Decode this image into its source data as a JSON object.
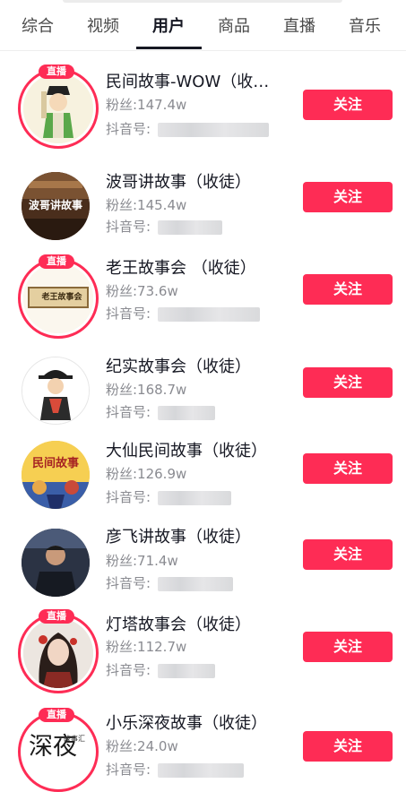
{
  "tabs": [
    {
      "label": "综合"
    },
    {
      "label": "视频"
    },
    {
      "label": "用户",
      "active": true
    },
    {
      "label": "商品"
    },
    {
      "label": "直播"
    },
    {
      "label": "音乐"
    }
  ],
  "live_badge_label": "直播",
  "users": [
    {
      "name": "民间故事-WOW（收…",
      "fans": "粉丝:147.4w",
      "id_label": "抖音号:",
      "live": true,
      "follow": "关注"
    },
    {
      "name": "波哥讲故事（收徒）",
      "fans": "粉丝:145.4w",
      "id_label": "抖音号:",
      "live": false,
      "follow": "关注"
    },
    {
      "name": "老王故事会 （收徒）",
      "fans": "粉丝:73.6w",
      "id_label": "抖音号:",
      "live": true,
      "follow": "关注"
    },
    {
      "name": "纪实故事会（收徒）",
      "fans": "粉丝:168.7w",
      "id_label": "抖音号:",
      "live": false,
      "follow": "关注"
    },
    {
      "name": "大仙民间故事（收徒）",
      "fans": "粉丝:126.9w",
      "id_label": "抖音号:",
      "live": false,
      "follow": "关注"
    },
    {
      "name": "彦飞讲故事（收徒）",
      "fans": "粉丝:71.4w",
      "id_label": "抖音号:",
      "live": false,
      "follow": "关注"
    },
    {
      "name": "灯塔故事会（收徒）",
      "fans": "粉丝:112.7w",
      "id_label": "抖音号:",
      "live": true,
      "follow": "关注"
    },
    {
      "name": "小乐深夜故事（收徒）",
      "fans": "粉丝:24.0w",
      "id_label": "抖音号:",
      "live": true,
      "follow": "关注"
    }
  ],
  "avatar_texts": {
    "bo": "波哥讲故事",
    "wang": "老王故事会",
    "daxian": "民间故事",
    "xiaole_big": "深夜",
    "xiaole_small": "故事汇"
  },
  "colors": {
    "accent": "#fe2c55",
    "text_primary": "#161823",
    "text_secondary": "#8a8b91"
  }
}
